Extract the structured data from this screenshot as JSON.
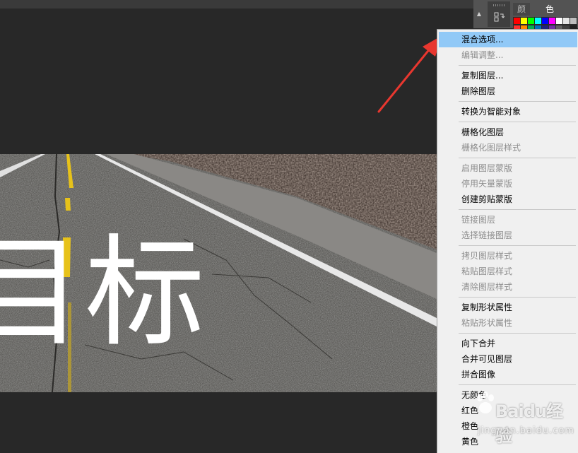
{
  "panel": {
    "tabs": [
      {
        "label": "颜色",
        "active": false
      },
      {
        "label": "色板",
        "active": true
      }
    ],
    "swatch_colors": [
      "#ff0000",
      "#ffff00",
      "#00ff00",
      "#00ffff",
      "#0000ff",
      "#ff00ff",
      "#ffffff",
      "#e6e6e6",
      "#bdbdbd"
    ],
    "swatch_colors_row2": [
      "#ff3030",
      "#ff8a00",
      "#00b050",
      "#0070c0",
      "#202080",
      "#7030a0",
      "#606060",
      "#404040",
      "#202020"
    ]
  },
  "canvas": {
    "characters": [
      "目",
      "标"
    ]
  },
  "context_menu": {
    "items": [
      {
        "label": "混合选项...",
        "state": "highlighted"
      },
      {
        "label": "编辑调整...",
        "state": "disabled"
      },
      {
        "label": "复制图层...",
        "state": "enabled"
      },
      {
        "label": "删除图层",
        "state": "enabled"
      },
      {
        "label": "转换为智能对象",
        "state": "enabled"
      },
      {
        "label": "栅格化图层",
        "state": "enabled"
      },
      {
        "label": "栅格化图层样式",
        "state": "disabled"
      },
      {
        "label": "启用图层蒙版",
        "state": "disabled"
      },
      {
        "label": "停用矢量蒙版",
        "state": "disabled"
      },
      {
        "label": "创建剪贴蒙版",
        "state": "enabled"
      },
      {
        "label": "链接图层",
        "state": "disabled"
      },
      {
        "label": "选择链接图层",
        "state": "disabled"
      },
      {
        "label": "拷贝图层样式",
        "state": "disabled"
      },
      {
        "label": "粘贴图层样式",
        "state": "disabled"
      },
      {
        "label": "清除图层样式",
        "state": "disabled"
      },
      {
        "label": "复制形状属性",
        "state": "enabled"
      },
      {
        "label": "粘贴形状属性",
        "state": "disabled"
      },
      {
        "label": "向下合并",
        "state": "enabled"
      },
      {
        "label": "合并可见图层",
        "state": "enabled"
      },
      {
        "label": "拼合图像",
        "state": "enabled"
      },
      {
        "label": "无颜色",
        "state": "enabled"
      },
      {
        "label": "红色",
        "state": "enabled"
      },
      {
        "label": "橙色",
        "state": "enabled"
      },
      {
        "label": "黄色",
        "state": "enabled"
      }
    ]
  },
  "watermark": {
    "brand": "Baidu经验",
    "url": "jingyan.baidu.com"
  },
  "colors": {
    "menu_highlight": "#91c9f7",
    "annotation_arrow": "#e8372f"
  }
}
